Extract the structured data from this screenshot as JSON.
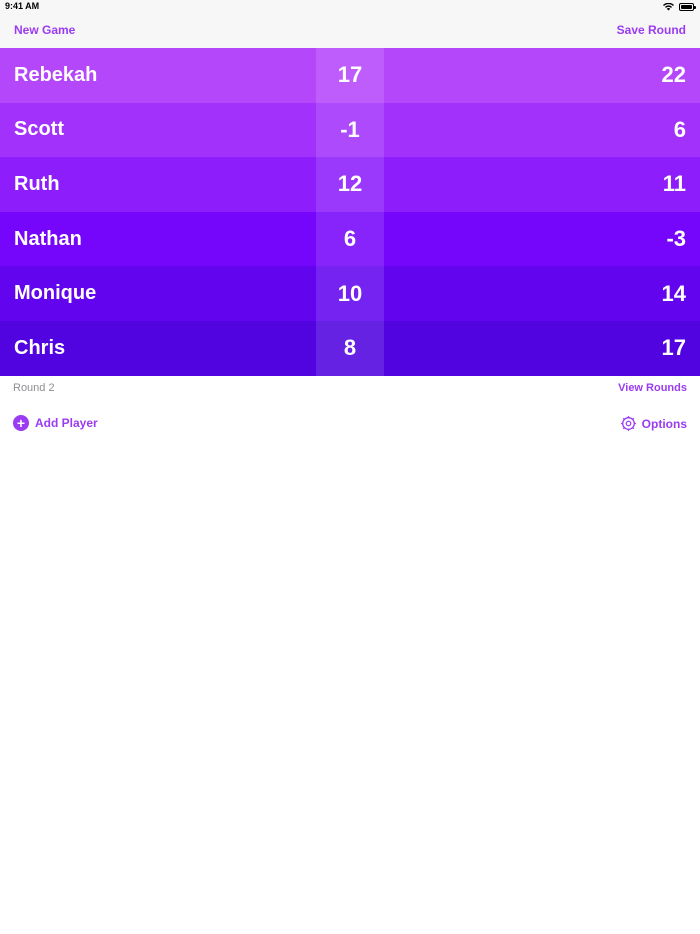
{
  "status": {
    "time": "9:41 AM"
  },
  "nav": {
    "new_game": "New Game",
    "save_round": "Save Round"
  },
  "players": [
    {
      "name": "Rebekah",
      "round": "17",
      "total": "22",
      "color": "#b547fb"
    },
    {
      "name": "Scott",
      "round": "-1",
      "total": "6",
      "color": "#a232fb"
    },
    {
      "name": "Ruth",
      "round": "12",
      "total": "11",
      "color": "#8d1dfb"
    },
    {
      "name": "Nathan",
      "round": "6",
      "total": "-3",
      "color": "#7606fb"
    },
    {
      "name": "Monique",
      "round": "10",
      "total": "14",
      "color": "#6205ee"
    },
    {
      "name": "Chris",
      "round": "8",
      "total": "17",
      "color": "#5104e0"
    }
  ],
  "info": {
    "round_label": "Round 2",
    "view_rounds": "View Rounds"
  },
  "actions": {
    "add_player": "Add Player",
    "options": "Options"
  },
  "icons": {
    "add": "plus-circle-icon",
    "options": "gear-icon",
    "wifi": "wifi-icon",
    "battery": "battery-icon"
  },
  "accent_color": "#9b3bf2"
}
